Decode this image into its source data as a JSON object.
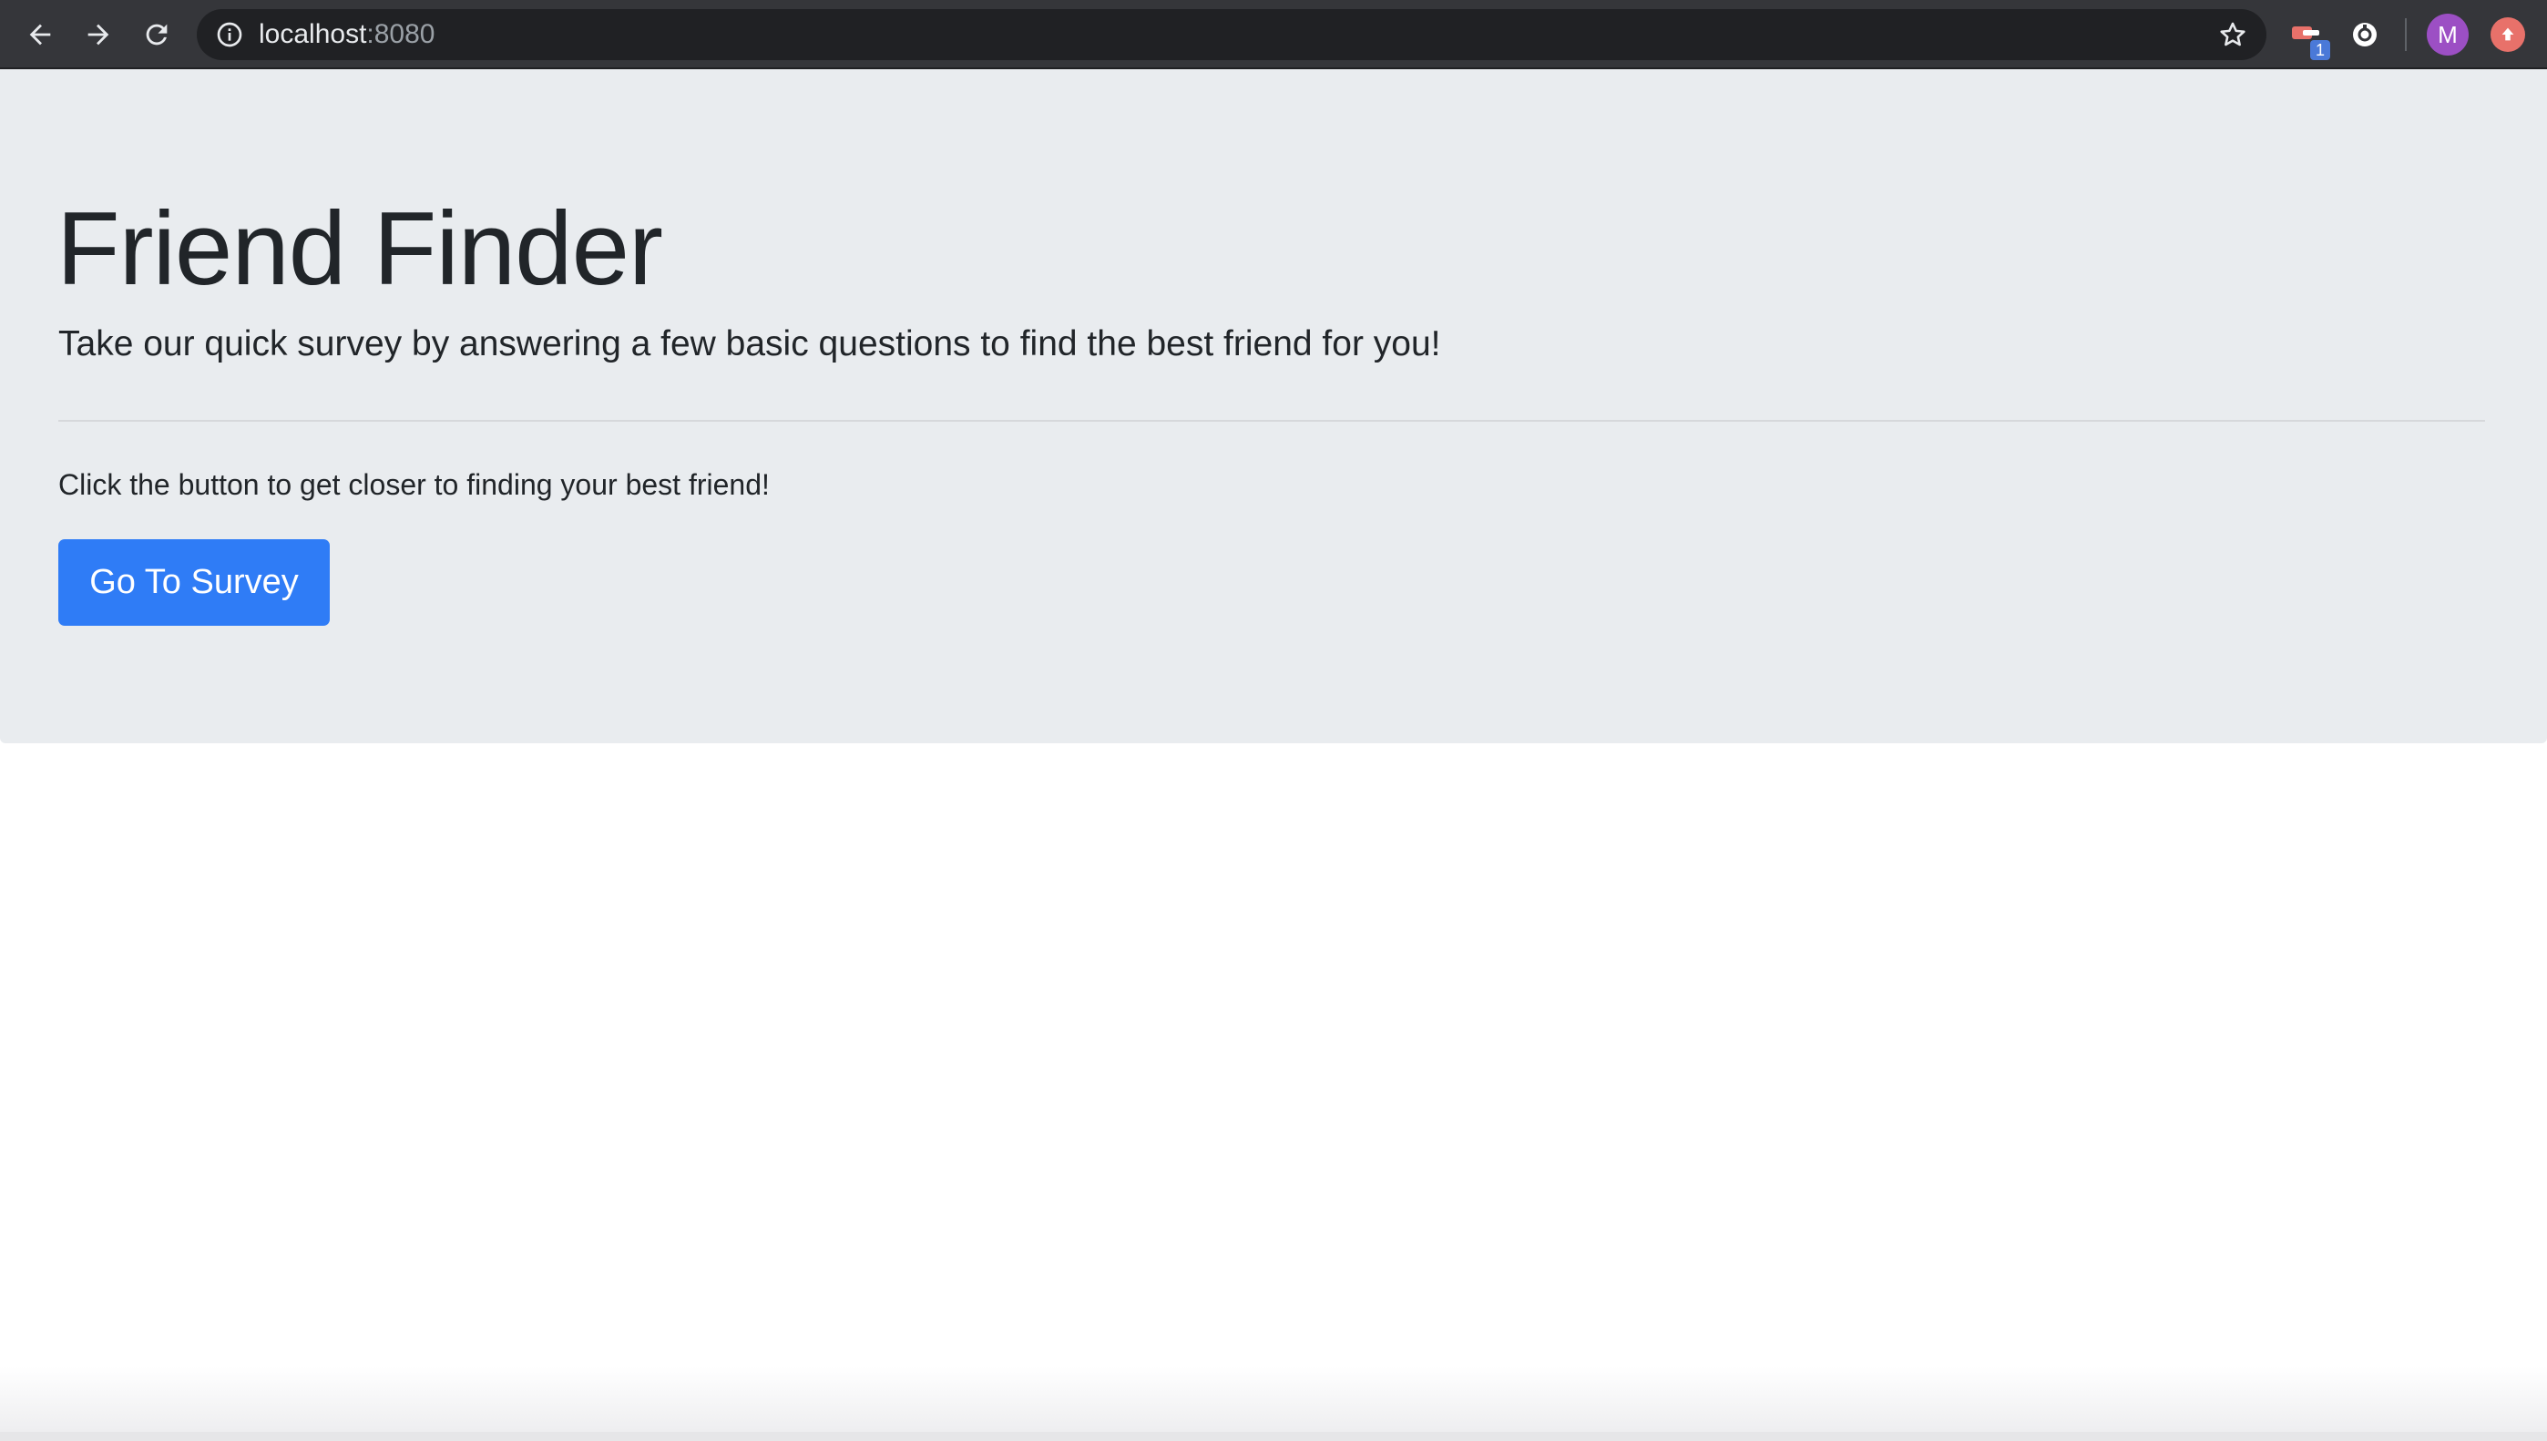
{
  "browser": {
    "url_host": "localhost",
    "url_port": ":8080",
    "profile_initial": "M",
    "extension_badge": "1",
    "icons": {
      "back": "arrow-left-icon",
      "forward": "arrow-right-icon",
      "reload": "reload-icon",
      "site_info": "info-icon",
      "bookmark": "star-icon",
      "extension_1": "extension-icon",
      "extension_2": "extension-icon",
      "update": "update-icon"
    }
  },
  "page": {
    "title": "Friend Finder",
    "lead": "Take our quick survey by answering a few basic questions to find the best friend for you!",
    "body": "Click the button to get closer to finding your best friend!",
    "button_label": "Go To Survey"
  },
  "colors": {
    "toolbar": "#35363a",
    "omnibox": "#202124",
    "jumbotron": "#e9ecef",
    "primary": "#2f7cf6",
    "text": "#212529",
    "avatar": "#9c4fc4"
  }
}
